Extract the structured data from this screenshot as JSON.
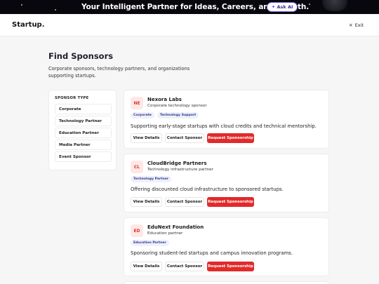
{
  "banner": {
    "text": "Your Intelligent Partner for Ideas, Careers, and Growth.",
    "ask_ai_label": "Ask AI",
    "ask_ai_icon": "sparkle-icon"
  },
  "header": {
    "logo": "Startup.",
    "exit_label": "Exit",
    "exit_icon": "close-icon"
  },
  "page": {
    "title": "Find Sponsors",
    "subtitle": "Corporate sponsors, technology partners, and organizations supporting startups."
  },
  "sidebar": {
    "title": "SPONSOR TYPE",
    "filters": [
      "Corporate",
      "Technology Partner",
      "Education Partner",
      "Media Partner",
      "Event Sponsor"
    ]
  },
  "sponsors": [
    {
      "initials": "NE",
      "name": "Nexora Labs",
      "type": "Corporate technology sponsor",
      "tags": [
        "Corporate",
        "Technology Support"
      ],
      "description": "Supporting early-stage startups with cloud credits and technical mentorship."
    },
    {
      "initials": "CL",
      "name": "CloudBridge Partners",
      "type": "Technology infrastructure partner",
      "tags": [
        "Technology Partner"
      ],
      "description": "Offering discounted cloud infrastructure to sponsored startups."
    },
    {
      "initials": "ED",
      "name": "EduNext Foundation",
      "type": "Education partner",
      "tags": [
        "Education Partner"
      ],
      "description": "Sponsoring student-led startups and campus innovation programs."
    }
  ],
  "actions": {
    "view": "View Details",
    "contact": "Contact Sponsor",
    "request": "Request Sponsorship"
  },
  "colors": {
    "banner_bg": "#07070d",
    "accent_red": "#e12a2a",
    "tag_bg": "#eef0fb",
    "tag_text": "#343a8e",
    "ask_ai_border": "#7b5cf0"
  }
}
